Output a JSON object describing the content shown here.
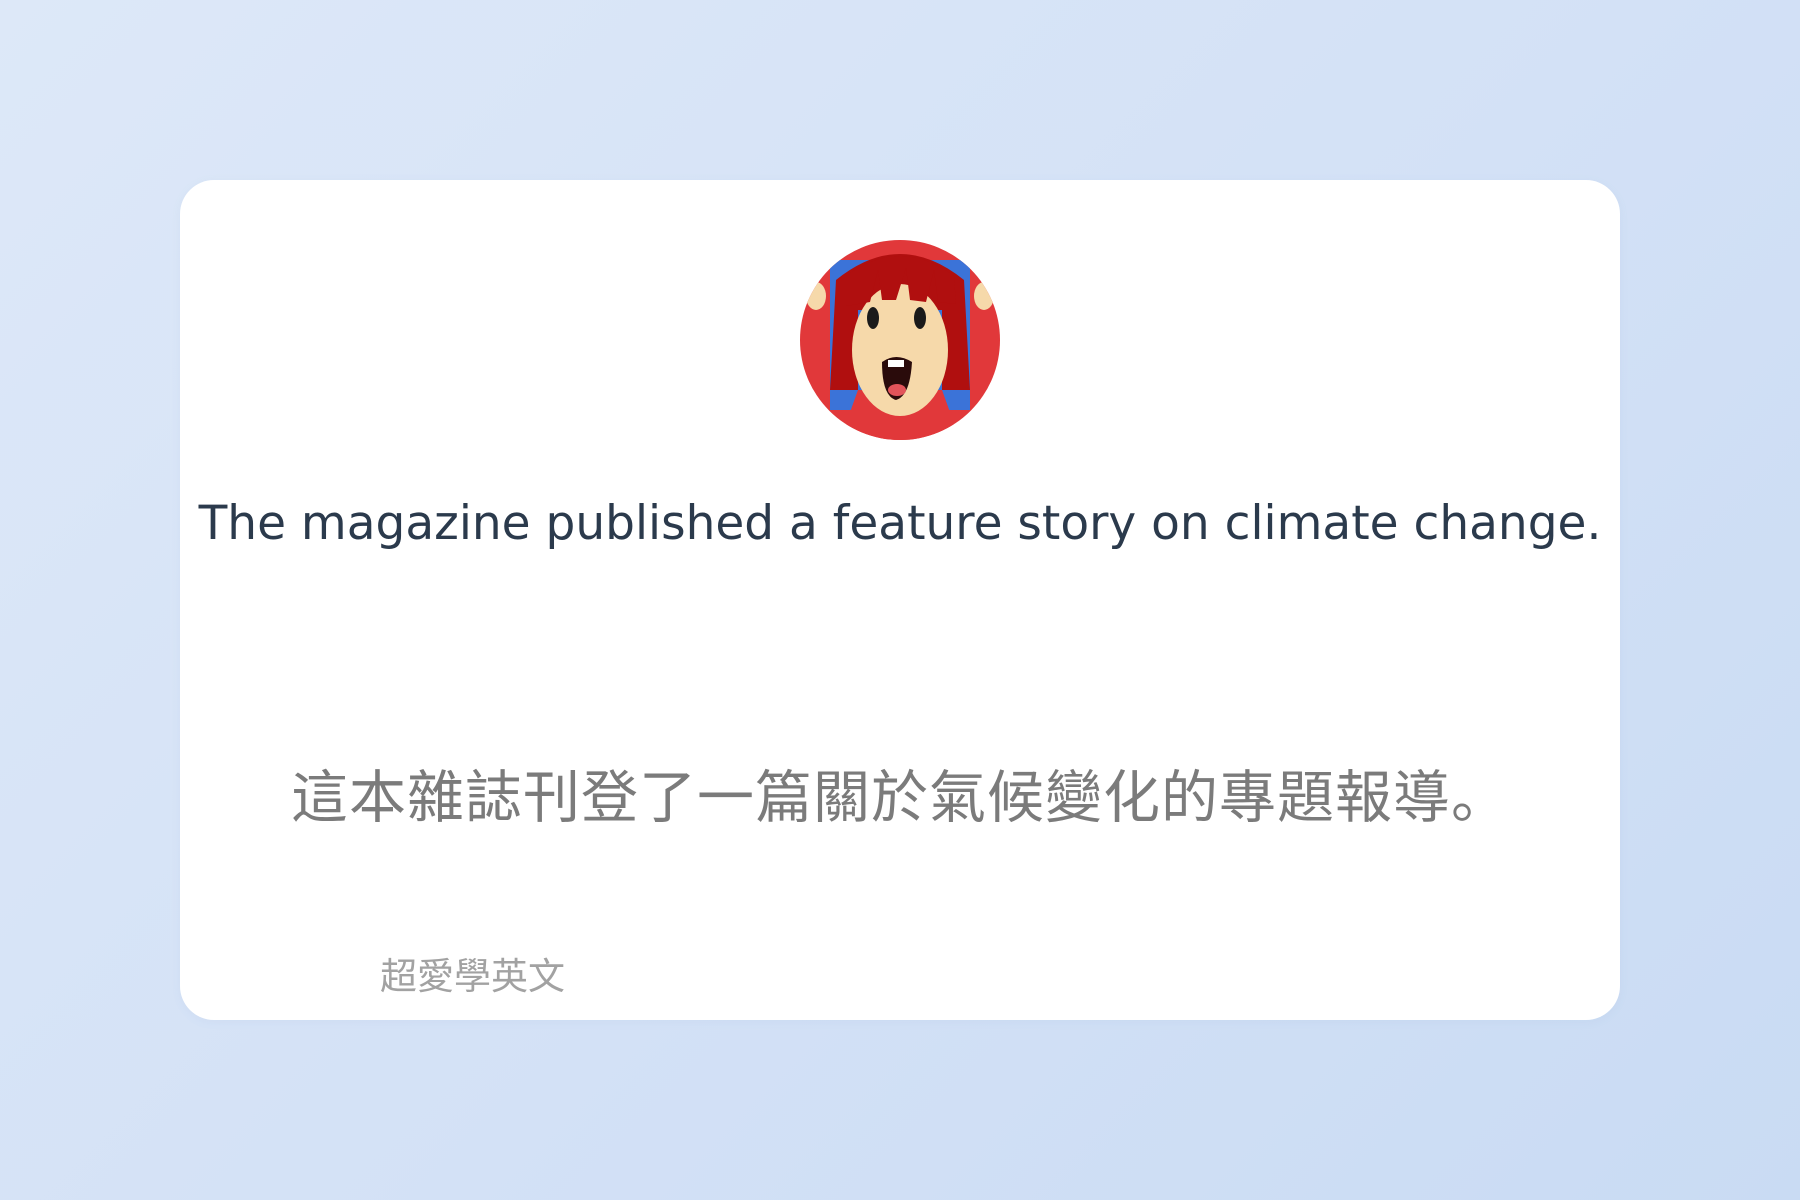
{
  "card": {
    "avatar": {
      "icon": "cartoon-girl-avatar-icon",
      "colors": {
        "ring": "#e1383a",
        "hair": "#b00f0f",
        "skin": "#f6d9aa",
        "background": "#3b73d8"
      }
    },
    "english_sentence": "The magazine published a feature story on climate change.",
    "chinese_translation": "這本雜誌刊登了一篇關於氣候變化的專題報導。",
    "footer_label": "超愛學英文"
  }
}
